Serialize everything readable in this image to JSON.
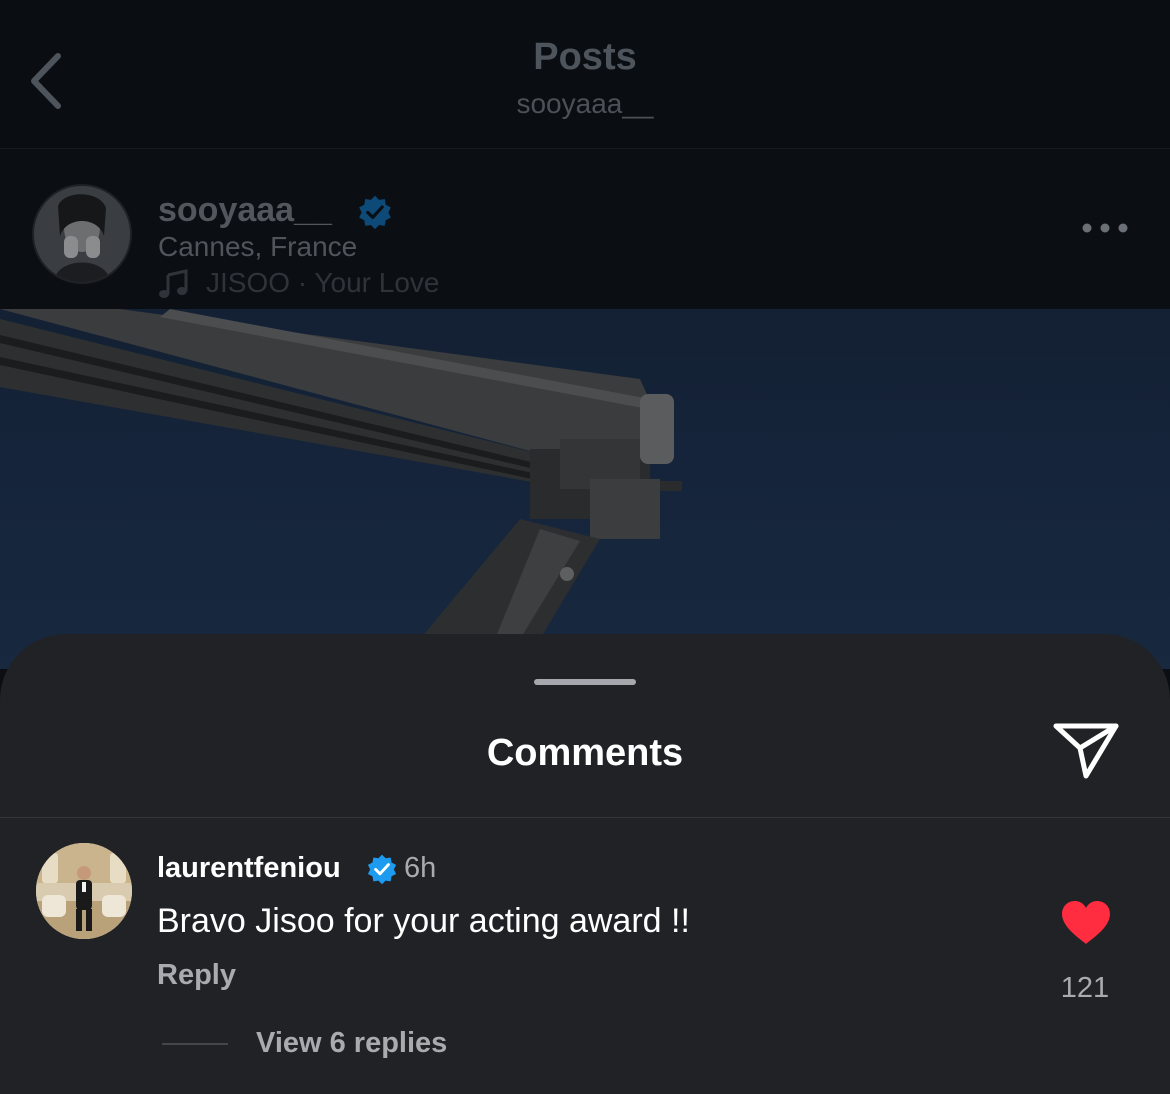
{
  "header": {
    "title": "Posts",
    "subtitle": "sooyaaa__"
  },
  "post": {
    "author": "sooyaaa__",
    "location": "Cannes, France",
    "music": "JISOO · Your Love",
    "image_sky_color": "#17283f"
  },
  "comments_sheet": {
    "title": "Comments",
    "comments": [
      {
        "username": "laurentfeniou",
        "time": "6h",
        "text": "Bravo Jisoo for your acting award !!",
        "reply_label": "Reply",
        "like_count": "121",
        "view_replies": "View 6 replies"
      }
    ]
  },
  "colors": {
    "verified": "#1d9bf0",
    "heart": "#ff2d3f",
    "sheet_bg": "#212226",
    "page_bg": "#0b0f14"
  },
  "icons": {
    "back": "chevron-left-icon",
    "verified": "verified-badge-icon",
    "music": "music-note-icon",
    "more": "more-horizontal-icon",
    "share": "send-icon",
    "like": "heart-icon"
  }
}
